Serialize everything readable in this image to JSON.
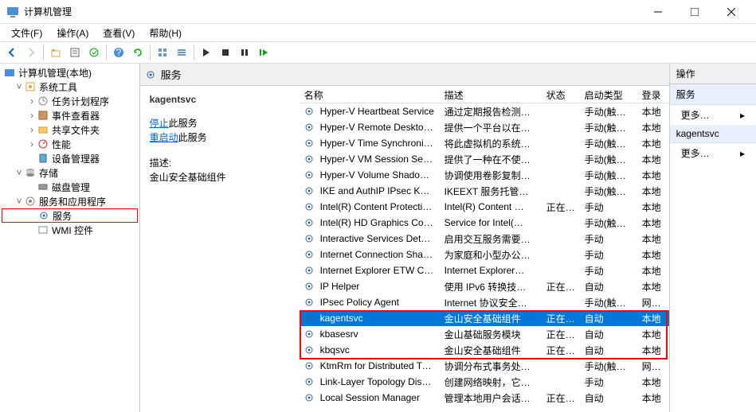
{
  "window": {
    "title": "计算机管理"
  },
  "menu": {
    "file": "文件(F)",
    "action": "操作(A)",
    "view": "查看(V)",
    "help": "帮助(H)"
  },
  "tree": {
    "root": "计算机管理(本地)",
    "systools": "系统工具",
    "tasksched": "任务计划程序",
    "eventvwr": "事件查看器",
    "shared": "共享文件夹",
    "perf": "性能",
    "devmgr": "设备管理器",
    "storage": "存储",
    "diskmgmt": "磁盘管理",
    "svcapps": "服务和应用程序",
    "services": "服务",
    "wmi": "WMI 控件"
  },
  "center": {
    "heading": "服务",
    "selected": "kagentsvc",
    "stop": "停止",
    "stop_suffix": "此服务",
    "restart": "重启动",
    "restart_suffix": "此服务",
    "desc_label": "描述:",
    "desc_text": "金山安全基础组件"
  },
  "cols": {
    "name": "名称",
    "desc": "描述",
    "status": "状态",
    "startup": "启动类型",
    "logon": "登录"
  },
  "rows": [
    {
      "n": "Hyper-V Heartbeat Service",
      "d": "通过定期报告检测…",
      "s": "",
      "t": "手动(触发…",
      "l": "本地"
    },
    {
      "n": "Hyper-V Remote Deskto…",
      "d": "提供一个平台以在…",
      "s": "",
      "t": "手动(触发…",
      "l": "本地"
    },
    {
      "n": "Hyper-V Time Synchroniz…",
      "d": "将此虚拟机的系统…",
      "s": "",
      "t": "手动(触发…",
      "l": "本地"
    },
    {
      "n": "Hyper-V VM Session Ser…",
      "d": "提供了一种在不使…",
      "s": "",
      "t": "手动(触发…",
      "l": "本地"
    },
    {
      "n": "Hyper-V Volume Shadow…",
      "d": "协调使用卷影复制…",
      "s": "",
      "t": "手动(触发…",
      "l": "本地"
    },
    {
      "n": "IKE and AuthIP IPsec Key…",
      "d": "IKEEXT 服务托管…",
      "s": "",
      "t": "手动(触发…",
      "l": "本地"
    },
    {
      "n": "Intel(R) Content Protectio…",
      "d": "Intel(R) Content …",
      "s": "正在…",
      "t": "手动",
      "l": "本地"
    },
    {
      "n": "Intel(R) HD Graphics Con…",
      "d": "Service for Intel(…",
      "s": "",
      "t": "手动(触发…",
      "l": "本地"
    },
    {
      "n": "Interactive Services Dete…",
      "d": "启用交互服务需要…",
      "s": "",
      "t": "手动",
      "l": "本地"
    },
    {
      "n": "Internet Connection Shari…",
      "d": "为家庭和小型办公…",
      "s": "",
      "t": "手动",
      "l": "本地"
    },
    {
      "n": "Internet Explorer ETW C…",
      "d": "Internet Explorer…",
      "s": "",
      "t": "手动",
      "l": "本地"
    },
    {
      "n": "IP Helper",
      "d": "使用 IPv6 转换技…",
      "s": "正在…",
      "t": "自动",
      "l": "本地"
    },
    {
      "n": "IPsec Policy Agent",
      "d": "Internet 协议安全…",
      "s": "",
      "t": "手动(触发…",
      "l": "网络服"
    },
    {
      "n": "kagentsvc",
      "d": "金山安全基础组件",
      "s": "正在…",
      "t": "自动",
      "l": "本地",
      "sel": true
    },
    {
      "n": "kbasesrv",
      "d": "金山基础服务模块",
      "s": "正在…",
      "t": "自动",
      "l": "本地"
    },
    {
      "n": "kbqsvc",
      "d": "金山安全基础组件",
      "s": "正在…",
      "t": "自动",
      "l": "本地"
    },
    {
      "n": "KtmRm for Distributed Tr…",
      "d": "协调分布式事务处…",
      "s": "",
      "t": "手动(触发…",
      "l": "网络服"
    },
    {
      "n": "Link-Layer Topology Disc…",
      "d": "创建网络映射，它…",
      "s": "",
      "t": "手动",
      "l": "本地"
    },
    {
      "n": "Local Session Manager",
      "d": "管理本地用户会话…",
      "s": "正在…",
      "t": "自动",
      "l": "本地"
    }
  ],
  "actions": {
    "header": "操作",
    "sec1": "服务",
    "more": "更多…",
    "sec2": "kagentsvc"
  }
}
